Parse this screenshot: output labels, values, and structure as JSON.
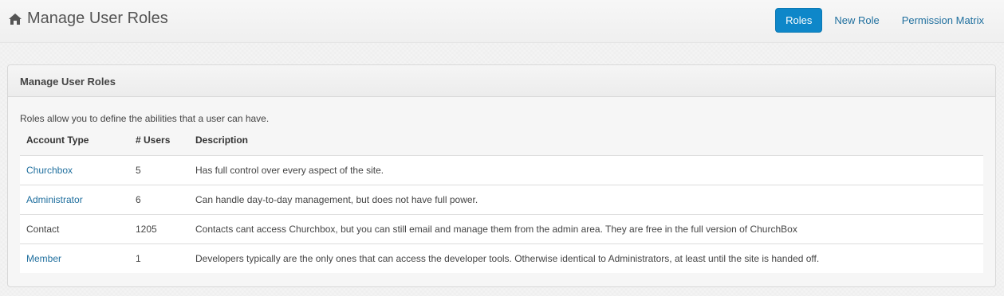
{
  "header": {
    "title": "Manage User Roles",
    "icon": "home-icon",
    "nav": [
      {
        "label": "Roles",
        "active": true
      },
      {
        "label": "New Role",
        "active": false
      },
      {
        "label": "Permission Matrix",
        "active": false
      }
    ]
  },
  "panel": {
    "heading": "Manage User Roles",
    "intro": "Roles allow you to define the abilities that a user can have.",
    "columns": [
      "Account Type",
      "# Users",
      "Description"
    ],
    "rows": [
      {
        "type": "Churchbox",
        "link": true,
        "users": "5",
        "description": "Has full control over every aspect of the site."
      },
      {
        "type": "Administrator",
        "link": true,
        "users": "6",
        "description": "Can handle day-to-day management, but does not have full power."
      },
      {
        "type": "Contact",
        "link": false,
        "users": "1205",
        "description": "Contacts cant access Churchbox, but you can still email and manage them from the admin area. They are free in the full version of ChurchBox"
      },
      {
        "type": "Member",
        "link": true,
        "users": "1",
        "description": "Developers typically are the only ones that can access the developer tools. Otherwise identical to Administrators, at least until the site is handed off."
      }
    ]
  },
  "colors": {
    "accent": "#0e87c9",
    "link": "#1f6f9e"
  }
}
